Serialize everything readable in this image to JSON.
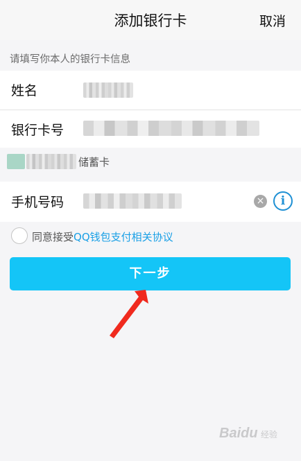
{
  "header": {
    "title": "添加银行卡",
    "cancel_label": "取消"
  },
  "form": {
    "hint": "请填写你本人的银行卡信息",
    "name_label": "姓名",
    "card_number_label": "银行卡号",
    "card_type": "储蓄卡",
    "phone_label": "手机号码"
  },
  "icons": {
    "clear": "clear-icon",
    "info": "info-icon"
  },
  "agreement": {
    "prefix": "同意接受",
    "link": "QQ钱包支付相关协议"
  },
  "next_button": {
    "label": "下一步"
  },
  "watermark": {
    "text": "Baidu",
    "sub": "经验"
  },
  "colors": {
    "accent": "#14c5f7",
    "link": "#1aa0e6",
    "info": "#1e90d4",
    "arrow": "#f02a1e"
  }
}
